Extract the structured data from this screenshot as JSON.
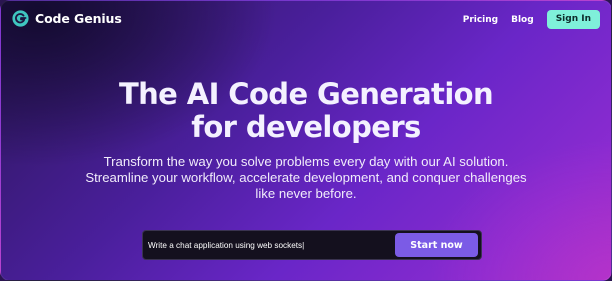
{
  "brand": {
    "name": "Code Genius",
    "icon": "code-genius-logo-icon",
    "icon_color": "#3fc6c0"
  },
  "nav": {
    "items": [
      {
        "label": "Pricing"
      },
      {
        "label": "Blog"
      }
    ],
    "signin_label": "Sign In",
    "signin_color": "#7ff0da"
  },
  "hero": {
    "title_lines": [
      "The AI Code Generation",
      "for developers"
    ],
    "subtitle_lines": [
      "Transform the way you solve problems every day with our AI solution.",
      "Streamline your workflow, accelerate development, and conquer challenges",
      "like never before."
    ]
  },
  "prompt": {
    "value": "Write a chat application using web sockets|",
    "button_label": "Start now",
    "button_color": "#7b5be6"
  }
}
